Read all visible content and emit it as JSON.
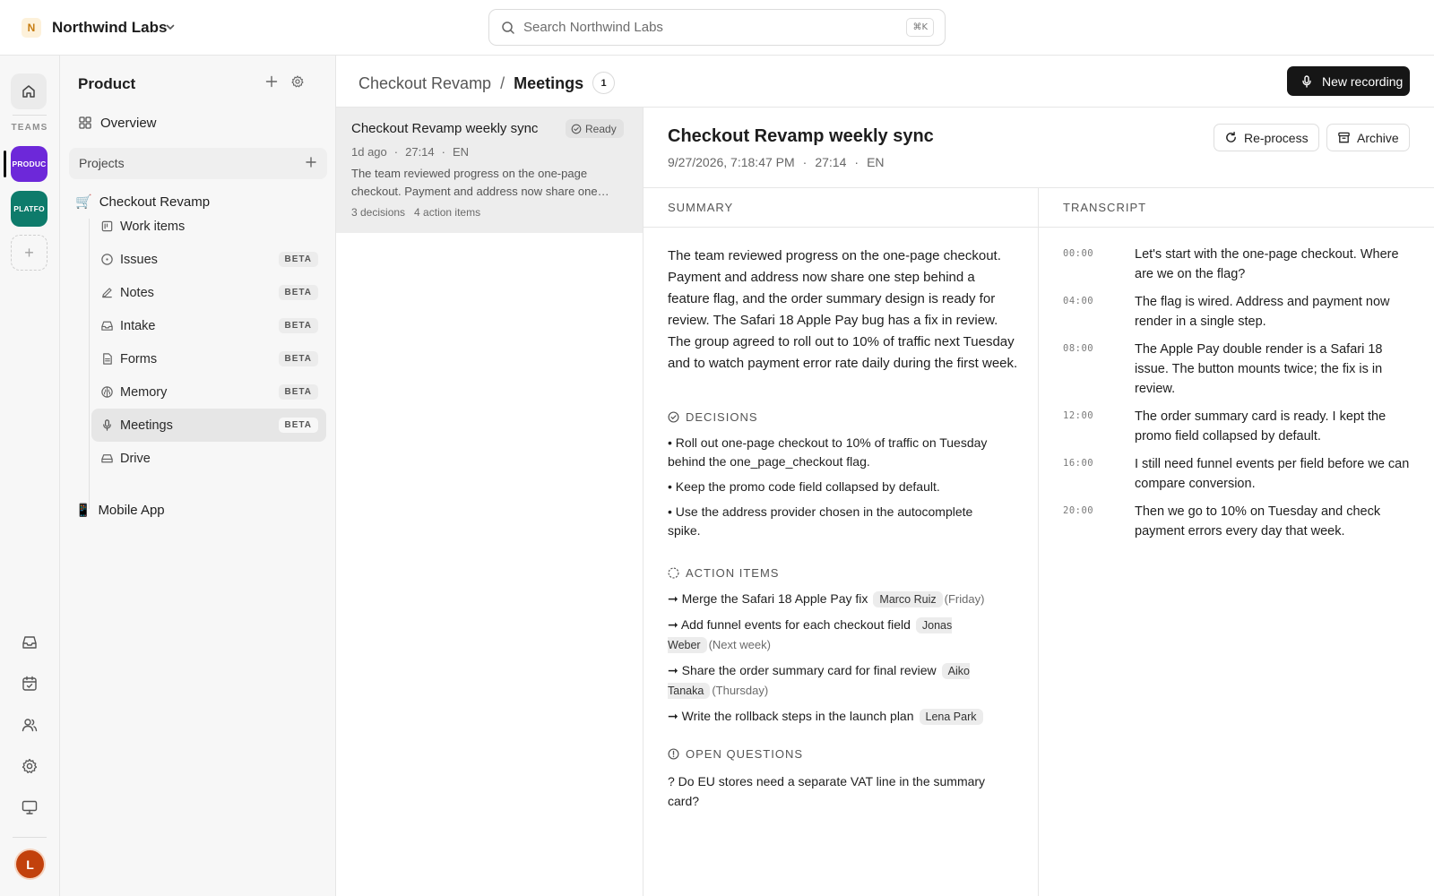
{
  "workspace": {
    "initial": "N",
    "name": "Northwind Labs"
  },
  "search": {
    "placeholder": "Search Northwind Labs",
    "shortcut": "⌘K"
  },
  "rail": {
    "teams_label": "TEAMS",
    "teams": [
      {
        "label": "PRODUC",
        "color": "#6d28d9",
        "active": true
      },
      {
        "label": "PLATFO",
        "color": "#0e7b6b",
        "active": false
      }
    ],
    "add_label": "+",
    "avatar_initial": "L",
    "bottom_icons": [
      "inbox-icon",
      "calendar-icon",
      "people-icon",
      "settings-icon",
      "monitor-icon"
    ]
  },
  "sidebar": {
    "title": "Product",
    "overview": "Overview",
    "projects_label": "Projects",
    "projects": [
      {
        "icon": "🛒",
        "name": "Checkout Revamp",
        "items": [
          {
            "label": "Work items",
            "icon": "work-items-icon",
            "badge": ""
          },
          {
            "label": "Issues",
            "icon": "issues-icon",
            "badge": "BETA"
          },
          {
            "label": "Notes",
            "icon": "notes-icon",
            "badge": "BETA"
          },
          {
            "label": "Intake",
            "icon": "intake-icon",
            "badge": "BETA"
          },
          {
            "label": "Forms",
            "icon": "forms-icon",
            "badge": "BETA"
          },
          {
            "label": "Memory",
            "icon": "memory-icon",
            "badge": "BETA"
          },
          {
            "label": "Meetings",
            "icon": "microphone-icon",
            "badge": "BETA",
            "active": true
          },
          {
            "label": "Drive",
            "icon": "drive-icon",
            "badge": ""
          }
        ]
      },
      {
        "icon": "📱",
        "name": "Mobile App"
      }
    ]
  },
  "header": {
    "project": "Checkout Revamp",
    "separator": "/",
    "current": "Meetings",
    "count": "1",
    "new_recording": "New recording"
  },
  "meeting_list": [
    {
      "title": "Checkout Revamp weekly sync",
      "status": "Ready",
      "age": "1d ago",
      "duration": "27:14",
      "language": "EN",
      "summary": "The team reviewed progress on the one-page checkout. Payment and address now share one…",
      "decisions_count": "3 decisions",
      "action_items_count": "4 action items"
    }
  ],
  "detail": {
    "title": "Checkout Revamp weekly sync",
    "datetime": "9/27/2026, 7:18:47 PM",
    "duration": "27:14",
    "language": "EN",
    "reprocess_label": "Re-process",
    "archive_label": "Archive",
    "summary_heading": "SUMMARY",
    "transcript_heading": "TRANSCRIPT",
    "summary": "The team reviewed progress on the one-page checkout. Payment and address now share one step behind a feature flag, and the order summary design is ready for review. The Safari 18 Apple Pay bug has a fix in review. The group agreed to roll out to 10% of traffic next Tuesday and to watch payment error rate daily during the first week.",
    "decisions_heading": "DECISIONS",
    "decisions": [
      "• Roll out one-page checkout to 10% of traffic on Tuesday behind the one_page_checkout flag.",
      "• Keep the promo code field collapsed by default.",
      "• Use the address provider chosen in the autocomplete spike."
    ],
    "action_items_heading": "ACTION ITEMS",
    "action_items": [
      {
        "text": "➞ Merge the Safari 18 Apple Pay fix",
        "owner": "Marco Ruiz",
        "due": "(Friday)"
      },
      {
        "text": "➞ Add funnel events for each checkout field",
        "owner": "Jonas Weber",
        "due": "(Next week)"
      },
      {
        "text": "➞ Share the order summary card for final review",
        "owner": "Aiko Tanaka",
        "due": "(Thursday)"
      },
      {
        "text": "➞ Write the rollback steps in the launch plan",
        "owner": "Lena Park",
        "due": ""
      }
    ],
    "open_questions_heading": "OPEN QUESTIONS",
    "open_questions": [
      "? Do EU stores need a separate VAT line in the summary card?"
    ],
    "transcript": [
      {
        "time": "00:00",
        "text": "Let's start with the one-page checkout. Where are we on the flag?"
      },
      {
        "time": "04:00",
        "text": "The flag is wired. Address and payment now render in a single step."
      },
      {
        "time": "08:00",
        "text": "The Apple Pay double render is a Safari 18 issue. The button mounts twice; the fix is in review."
      },
      {
        "time": "12:00",
        "text": "The order summary card is ready. I kept the promo field collapsed by default."
      },
      {
        "time": "16:00",
        "text": "I still need funnel events per field before we can compare conversion."
      },
      {
        "time": "20:00",
        "text": "Then we go to 10% on Tuesday and check payment errors every day that week."
      }
    ]
  }
}
